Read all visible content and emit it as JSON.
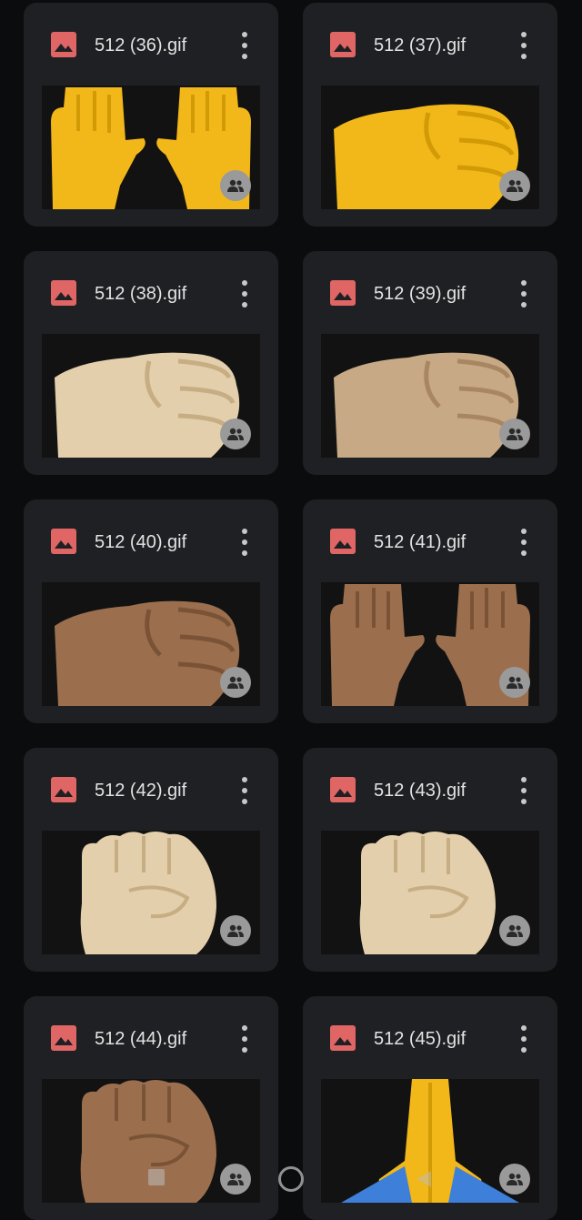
{
  "files": [
    {
      "name": "512 (36).gif",
      "thumb": "raised-hands-yellow-icon"
    },
    {
      "name": "512 (37).gif",
      "thumb": "left-fist-yellow-icon"
    },
    {
      "name": "512 (38).gif",
      "thumb": "left-fist-light-icon"
    },
    {
      "name": "512 (39).gif",
      "thumb": "left-fist-medium-light-icon"
    },
    {
      "name": "512 (40).gif",
      "thumb": "left-fist-medium-icon"
    },
    {
      "name": "512 (41).gif",
      "thumb": "raised-hands-medium-icon"
    },
    {
      "name": "512 (42).gif",
      "thumb": "raised-fist-light-icon"
    },
    {
      "name": "512 (43).gif",
      "thumb": "raised-fist-light-icon"
    },
    {
      "name": "512 (44).gif",
      "thumb": "raised-fist-medium-icon"
    },
    {
      "name": "512 (45).gif",
      "thumb": "folded-hands-yellow-icon"
    }
  ],
  "colors": {
    "background": "#0b0c0d",
    "card": "#1f2023",
    "image_icon": "#e06666",
    "text": "#e3e3e3",
    "yellow": "#f2b718",
    "light": "#e3cfab",
    "medium_light": "#c7a985",
    "medium": "#9b6f4e",
    "medium_dark": "#8a6446"
  },
  "nav": {
    "recents": "square-icon",
    "home": "circle-icon",
    "back": "triangle-back-icon"
  }
}
